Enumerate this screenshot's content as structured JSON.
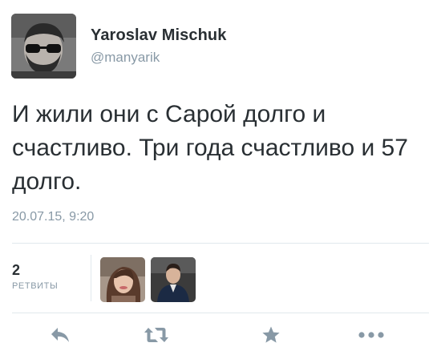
{
  "author": {
    "name": "Yaroslav Mischuk",
    "handle": "@manyarik"
  },
  "tweet": {
    "text": "И жили они с Сарой долго и счастливо. Три года счастливо и 57 долго.",
    "timestamp": "20.07.15, 9:20"
  },
  "stats": {
    "retweet_count": "2",
    "retweet_label": "РЕТВИТЫ"
  },
  "actions": {
    "reply_icon": "reply-icon",
    "retweet_icon": "retweet-icon",
    "favorite_icon": "star-icon",
    "more_icon": "more-icon"
  },
  "colors": {
    "text": "#292f33",
    "muted": "#8899a6",
    "divider": "#e1e8ed",
    "icon": "#8899a6"
  }
}
